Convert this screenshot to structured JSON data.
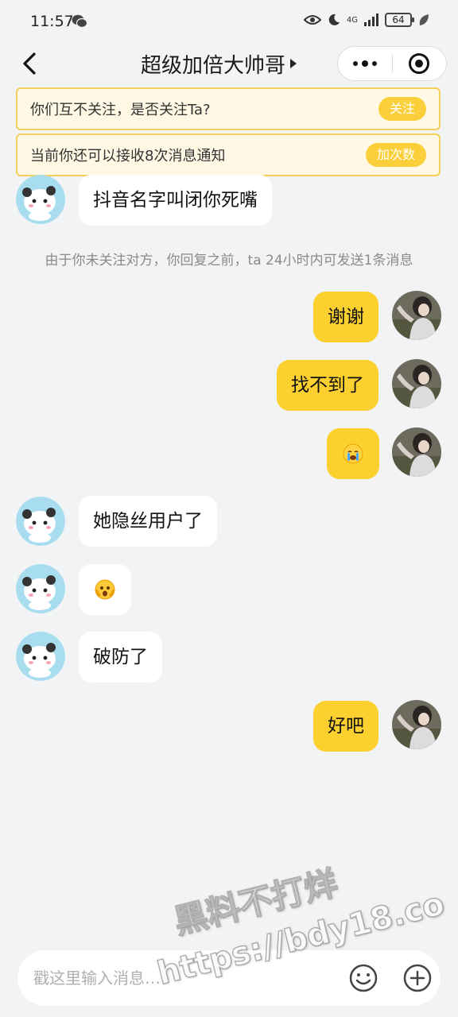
{
  "status_bar": {
    "time": "11:57",
    "network": "4G",
    "battery": "64"
  },
  "header": {
    "title": "超级加倍大帅哥"
  },
  "notices": [
    {
      "text": "你们互不关注，是否关注Ta?",
      "button": "关注"
    },
    {
      "text": "当前你还可以接收8次消息通知",
      "button": "加次数"
    }
  ],
  "messages": [
    {
      "side": "in",
      "text": "抖音名字叫闭你死嘴"
    },
    {
      "side": "system",
      "text": "由于你未关注对方，你回复之前，ta 24小时内可发送1条消息"
    },
    {
      "side": "out",
      "text": "谢谢"
    },
    {
      "side": "out",
      "text": "找不到了"
    },
    {
      "side": "out",
      "emoji": "crying-emoji"
    },
    {
      "side": "in",
      "text": "她隐丝用户了"
    },
    {
      "side": "in",
      "emoji": "shocked-emoji"
    },
    {
      "side": "in",
      "text": "破防了"
    },
    {
      "side": "out",
      "text": "好吧"
    }
  ],
  "watermark": {
    "line1": "黑料不打烊",
    "line2": "https://bdy18.co"
  },
  "input": {
    "placeholder": "戳这里输入消息…"
  },
  "colors": {
    "accent": "#fcd02f",
    "notice_border": "#f6cf58",
    "background": "#f2f3f5"
  }
}
